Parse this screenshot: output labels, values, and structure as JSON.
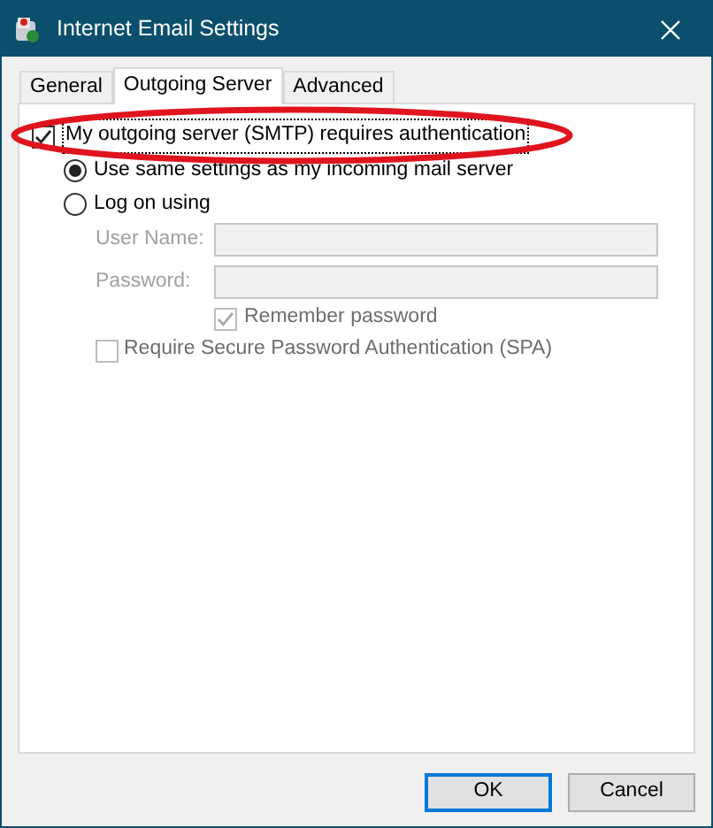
{
  "window": {
    "title": "Internet Email Settings"
  },
  "tabs": [
    {
      "label": "General",
      "selected": false
    },
    {
      "label": "Outgoing Server",
      "selected": true
    },
    {
      "label": "Advanced",
      "selected": false
    }
  ],
  "requires_authentication": {
    "label": "My outgoing server (SMTP) requires authentication",
    "checked": true
  },
  "logon_options": [
    {
      "label": "Use same settings as my incoming mail server",
      "selected": true
    },
    {
      "label": "Log on using",
      "selected": false
    }
  ],
  "fields": [
    {
      "label": "User Name:",
      "disabled": true
    },
    {
      "label": "Password:",
      "disabled": true
    }
  ],
  "remember_password": {
    "label": "Remember password",
    "checked": true,
    "disabled": true
  },
  "require_spa": {
    "label": "Require Secure Password Authentication (SPA)",
    "checked": false,
    "disabled": true
  },
  "annotation": {
    "kind": "ellipse"
  },
  "buttons": [
    {
      "label": "OK",
      "default": true
    },
    {
      "label": "Cancel",
      "default": false
    }
  ]
}
